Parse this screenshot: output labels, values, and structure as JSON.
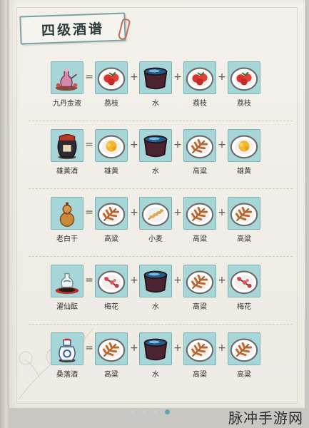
{
  "title": "四级酒谱",
  "watermark": "脉冲手游网",
  "pager": {
    "count": 4,
    "active": 3
  },
  "recipes": [
    {
      "product": {
        "label": "九丹金液",
        "icon": "elixir-vase-icon"
      },
      "ingredients": [
        {
          "label": "荔枝",
          "icon": "lychee-icon"
        },
        {
          "label": "水",
          "icon": "water-bowl-icon"
        },
        {
          "label": "荔枝",
          "icon": "lychee-icon"
        },
        {
          "label": "荔枝",
          "icon": "lychee-icon"
        }
      ]
    },
    {
      "product": {
        "label": "雄黄酒",
        "icon": "wine-jar-icon"
      },
      "ingredients": [
        {
          "label": "雄黄",
          "icon": "realgar-icon"
        },
        {
          "label": "水",
          "icon": "water-bowl-icon"
        },
        {
          "label": "高粱",
          "icon": "sorghum-icon"
        },
        {
          "label": "雄黄",
          "icon": "realgar-icon"
        }
      ]
    },
    {
      "product": {
        "label": "老白干",
        "icon": "gourd-icon"
      },
      "ingredients": [
        {
          "label": "高粱",
          "icon": "sorghum-icon"
        },
        {
          "label": "小麦",
          "icon": "wheat-icon"
        },
        {
          "label": "高粱",
          "icon": "sorghum-icon"
        },
        {
          "label": "高粱",
          "icon": "sorghum-icon"
        }
      ]
    },
    {
      "product": {
        "label": "濯仙酝",
        "icon": "porcelain-pot-icon"
      },
      "ingredients": [
        {
          "label": "梅花",
          "icon": "plum-blossom-icon"
        },
        {
          "label": "水",
          "icon": "water-bowl-icon"
        },
        {
          "label": "高粱",
          "icon": "sorghum-icon"
        },
        {
          "label": "梅花",
          "icon": "plum-blossom-icon"
        }
      ]
    },
    {
      "product": {
        "label": "桑落酒",
        "icon": "blue-jar-icon"
      },
      "ingredients": [
        {
          "label": "高粱",
          "icon": "sorghum-icon"
        },
        {
          "label": "水",
          "icon": "water-bowl-icon"
        },
        {
          "label": "高粱",
          "icon": "sorghum-icon"
        },
        {
          "label": "高粱",
          "icon": "sorghum-icon"
        }
      ]
    }
  ],
  "operators": {
    "equals": "=",
    "plus": "+"
  }
}
